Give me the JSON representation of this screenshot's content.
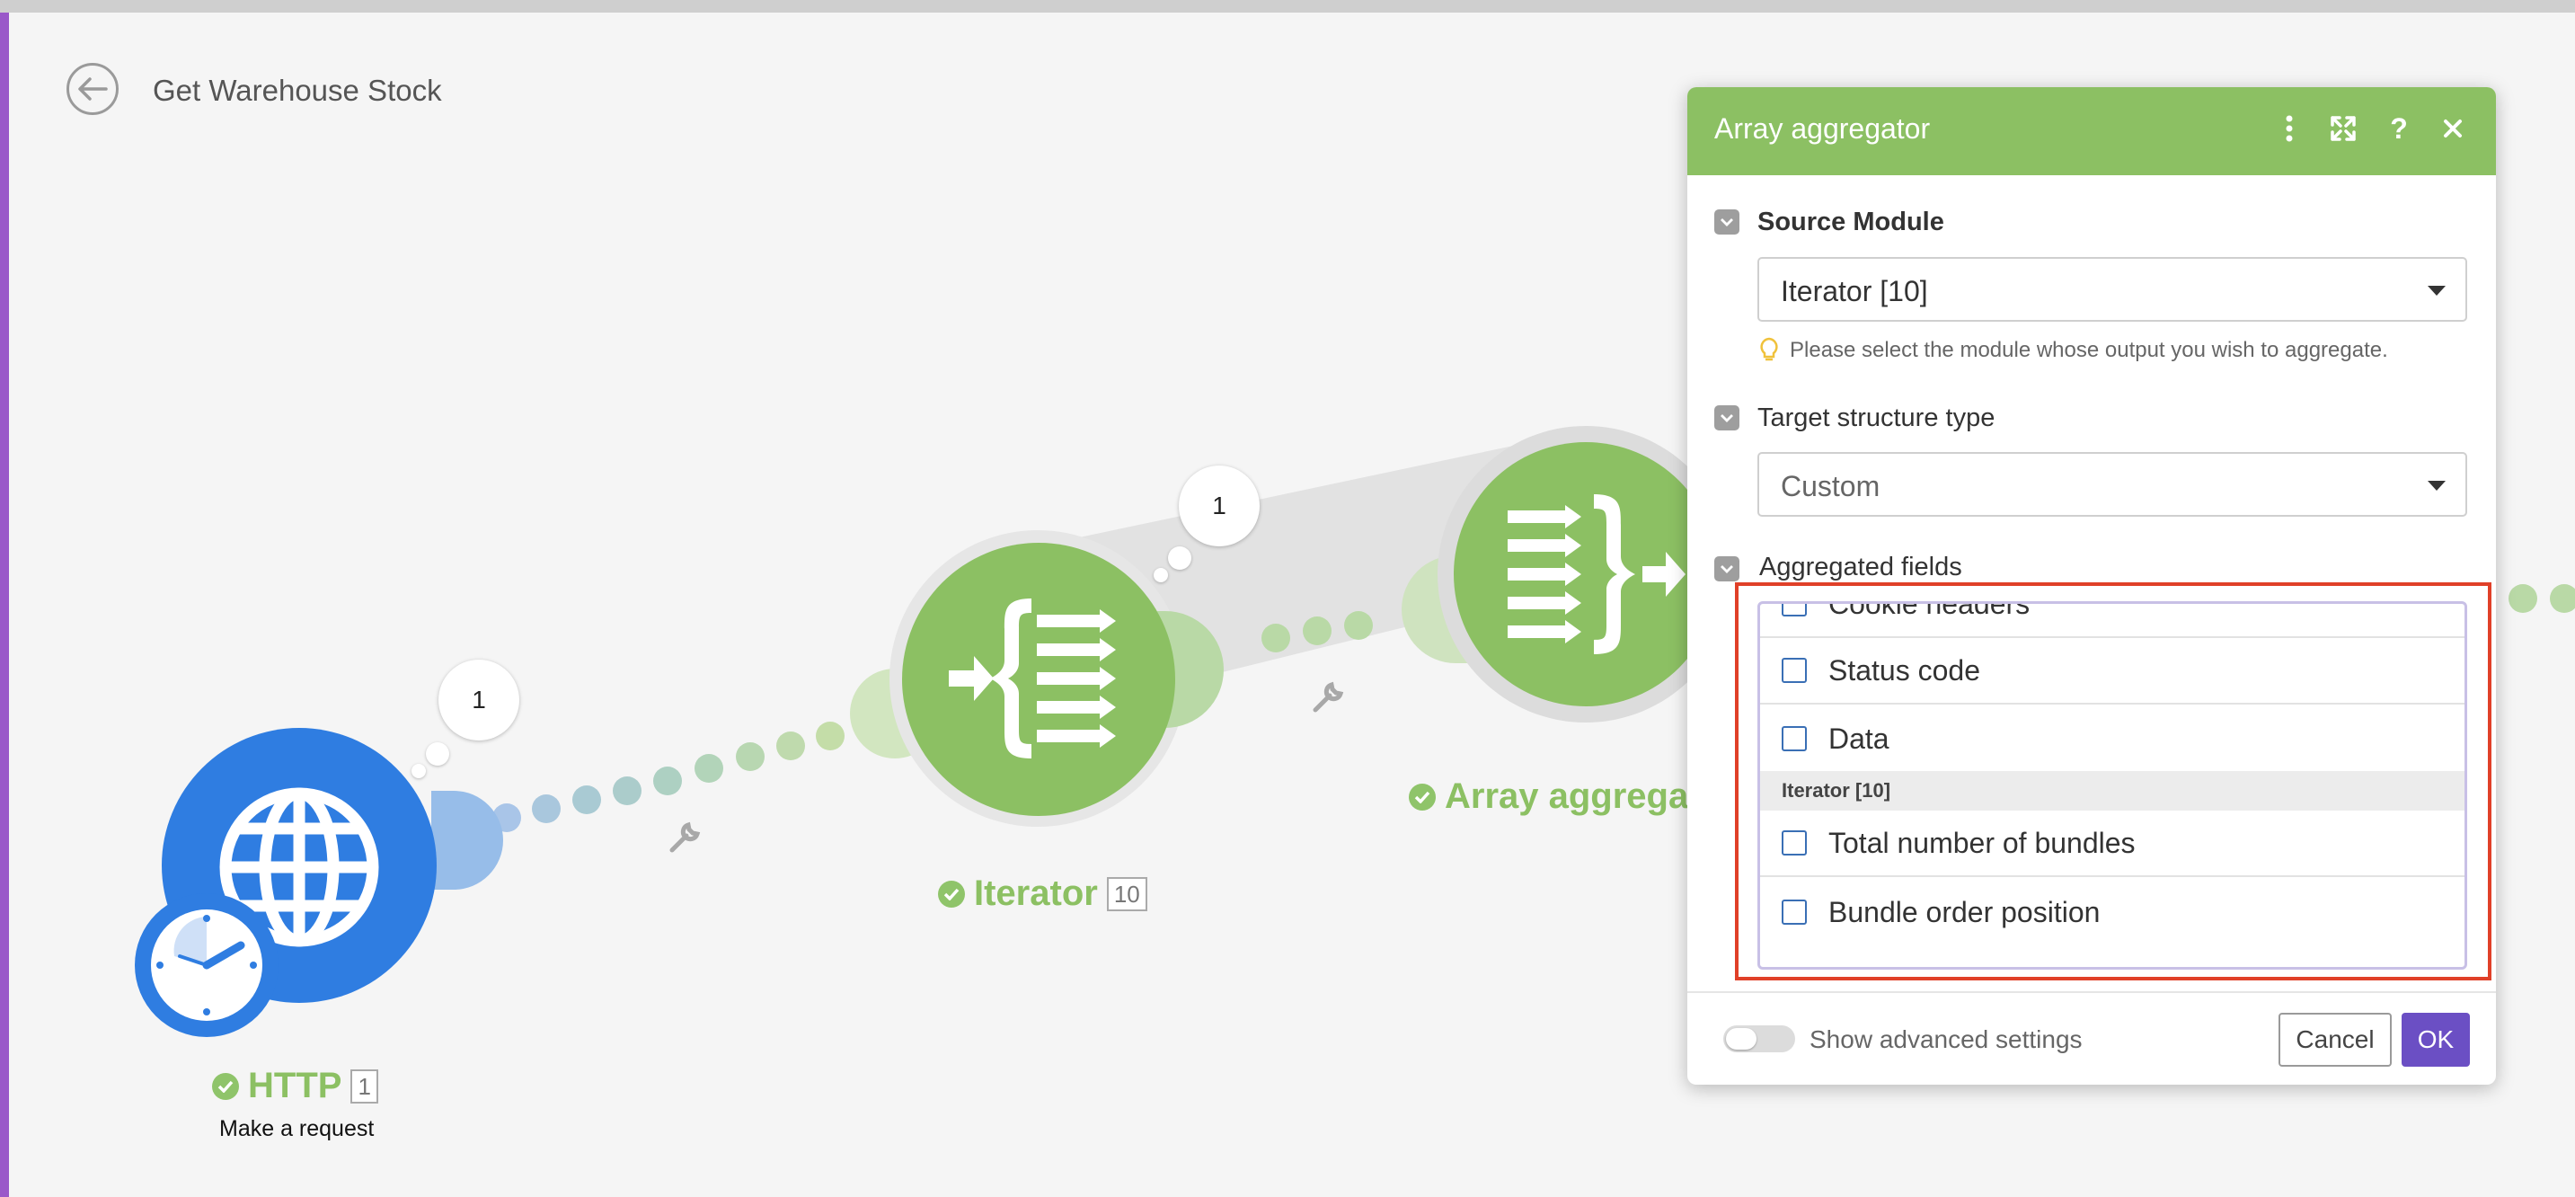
{
  "scenario": {
    "title": "Get Warehouse Stock"
  },
  "modules": {
    "http": {
      "name": "HTTP",
      "badge": "1",
      "subtitle": "Make a request",
      "bubble": "1"
    },
    "iterator": {
      "name": "Iterator",
      "badge": "10",
      "bubble": "1"
    },
    "aggregator": {
      "name": "Array aggrega"
    }
  },
  "panel": {
    "title": "Array aggregator",
    "icons": [
      "more-vertical-icon",
      "expand-icon",
      "help-icon",
      "close-icon"
    ],
    "source_module": {
      "label": "Source Module",
      "value": "Iterator [10]",
      "hint": "Please select the module whose output you wish to aggregate."
    },
    "target_structure": {
      "label": "Target structure type",
      "value": "Custom"
    },
    "aggregated_fields": {
      "label": "Aggregated fields",
      "items": [
        "Cookie headers",
        "Status code",
        "Data"
      ],
      "group": "Iterator [10]",
      "group_items": [
        "Total number of bundles",
        "Bundle order position"
      ]
    },
    "footer": {
      "toggle_label": "Show advanced settings",
      "cancel": "Cancel",
      "ok": "OK"
    }
  },
  "colors": {
    "module_green": "#8cc063",
    "http_blue": "#2f7de1",
    "accent_purple": "#6b4fc4",
    "highlight_red": "#e04028"
  }
}
